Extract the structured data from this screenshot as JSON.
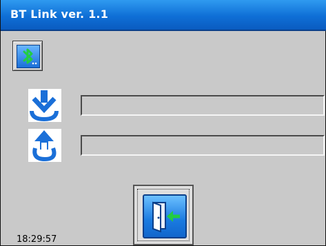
{
  "window": {
    "title": "BT Link ver. 1.1"
  },
  "toolbar": {
    "bluetooth_button_icon": "bluetooth-icon"
  },
  "transfer": {
    "download_icon": "download-arrow-icon",
    "upload_icon": "upload-arrow-icon",
    "download_progress": 0,
    "upload_progress": 0
  },
  "actions": {
    "exit_icon": "exit-door-icon"
  },
  "status": {
    "time": "18:29:57"
  },
  "colors": {
    "title_bar": "#1478e0",
    "accent_blue": "#1a6fd8",
    "icon_green": "#22cc44",
    "background": "#c9c9c9"
  }
}
